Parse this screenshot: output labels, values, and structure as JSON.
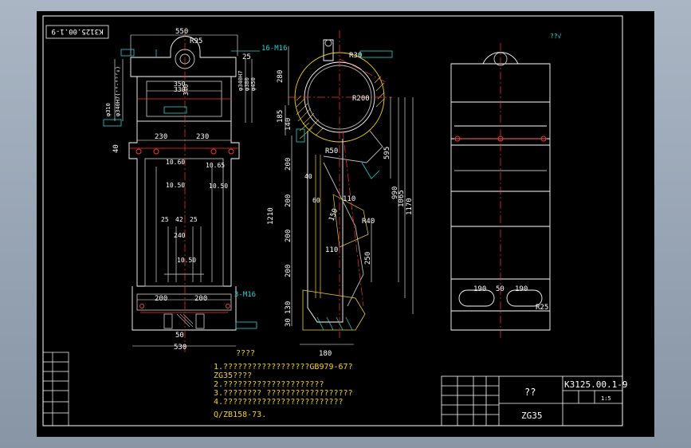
{
  "frame_code_rotated": "K3125.00.1-9",
  "front_view": {
    "width_top": "550",
    "radius_top": "R95",
    "holes_label": "16-M16",
    "dim_25": "25",
    "dim_330": "330",
    "dim_340": "340",
    "dim_350": "350",
    "phi_380": "φ380",
    "phi_450": "φ450",
    "phi_310": "φ310",
    "phi_340h7": "φ340H7",
    "dia_left": "φ340H7(⁺⁰·⁰⁵⁷₀)",
    "dim_230a": "230",
    "dim_230b": "230",
    "dim_40": "40",
    "rib_1": "10.60",
    "rib_2": "10.50",
    "rib_3": "10.65",
    "rib_4": "10.50",
    "dim_25b": "25",
    "dim_42": "42",
    "dim_25c": "25",
    "dim_240": "240",
    "rib_5": "10.50",
    "dim_200a": "200",
    "dim_200b": "200",
    "bottom_holes": "3-M16",
    "dim_530": "530",
    "dim_50": "50"
  },
  "side_view": {
    "r30": "R30",
    "r200": "R200",
    "r50": "R50",
    "r40": "R40",
    "dim_280": "280",
    "dim_185": "185",
    "dim_140": "140",
    "dim_200a": "200",
    "dim_200b": "200",
    "dim_200c": "200",
    "dim_200d": "200",
    "dim_1210": "1210",
    "dim_595": "595",
    "dim_990": "990",
    "dim_1065": "1065",
    "dim_1170": "1170",
    "dim_110a": "110",
    "dim_110b": "110",
    "dim_150": "150",
    "dim_250": "250",
    "dim_130": "130",
    "dim_30": "30",
    "dim_180": "180",
    "dim_60": "60",
    "dim_40": "40",
    "angle_ref": "∠"
  },
  "right_view": {
    "surface_note": "??√",
    "dim_190a": "190",
    "dim_50": "50",
    "dim_190b": "190",
    "r25": "R25"
  },
  "notes": {
    "heading": "????",
    "line1": "1.??????????????????GB979-67?",
    "line2": "ZG35????",
    "line3": "2.?????????????????????",
    "line4": "3.????????  ??????????????????",
    "line5": "4.?????????????????????????",
    "line6": "Q/ZB158-73."
  },
  "title_block": {
    "name": "??",
    "code": "K3125.00.1-9",
    "material": "ZG35",
    "scale": "1:5"
  }
}
